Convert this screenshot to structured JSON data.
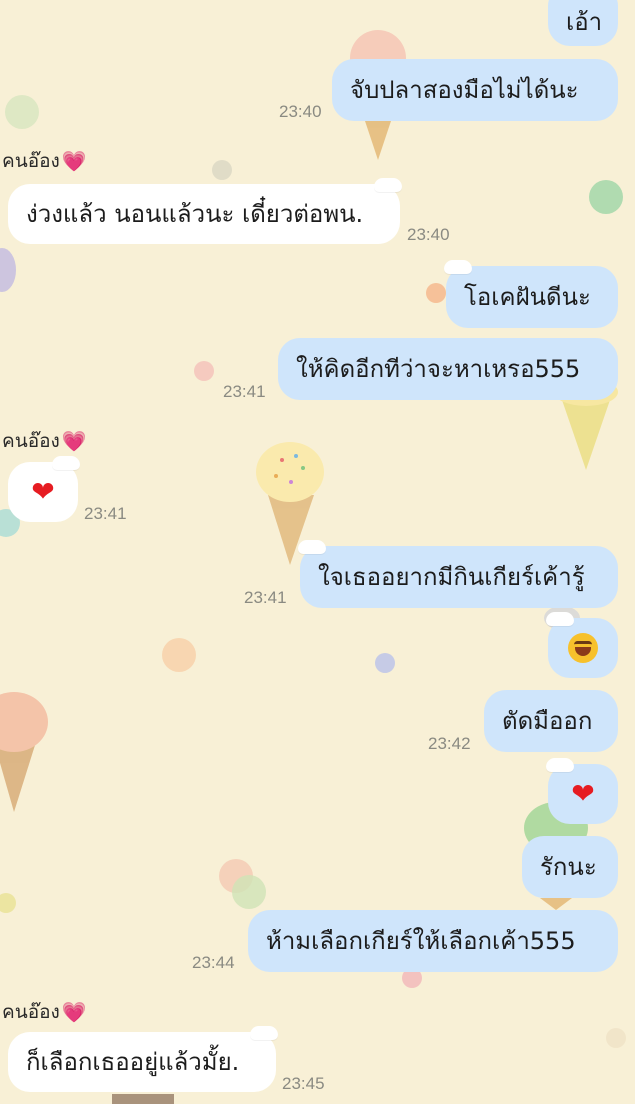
{
  "chat": {
    "messages": [
      {
        "from": "me",
        "text": "เอ้า"
      },
      {
        "from": "me",
        "text": "จับปลาสองมือไม่ได้นะ",
        "time": "23:40"
      },
      {
        "from": "them",
        "sender": "คนอ๊อง",
        "text": "ง่วงแล้ว นอนแล้วนะ เดี๋ยวต่อพน.",
        "time": "23:40"
      },
      {
        "from": "me",
        "text": "โอเคฝันดีนะ"
      },
      {
        "from": "me",
        "text": "ให้คิดอีกทีว่าจะหาเหรอ555",
        "time": "23:41"
      },
      {
        "from": "them",
        "sender": "คนอ๊อง",
        "text": "❤",
        "time": "23:41"
      },
      {
        "from": "me",
        "text": "ใจเธออยากมีกินเกียร์เค้ารู้",
        "time": "23:41"
      },
      {
        "from": "me",
        "emoji": "rolling-laughing-face-icon"
      },
      {
        "from": "me",
        "text": "ตัดมืออก",
        "time": "23:42"
      },
      {
        "from": "me",
        "text": "❤"
      },
      {
        "from": "me",
        "text": "รักนะ"
      },
      {
        "from": "me",
        "text": "ห้ามเลือกเกียร์ให้เลือกเค้า555",
        "time": "23:44"
      },
      {
        "from": "them",
        "sender": "คนอ๊อง",
        "text": "ก็เลือกเธออยู่แล้วมั้ย.",
        "time": "23:45"
      }
    ]
  },
  "sender_heart": "💗",
  "colors": {
    "background": "#f8f0d6",
    "my_bubble": "#cfe5fb",
    "their_bubble": "#ffffff",
    "timestamp": "#8a8a82",
    "heart_red": "#e61c22",
    "heart_pink": "#e55aa7"
  },
  "background_decor": [
    "ice-cream-cone-icon",
    "polka-dot"
  ]
}
